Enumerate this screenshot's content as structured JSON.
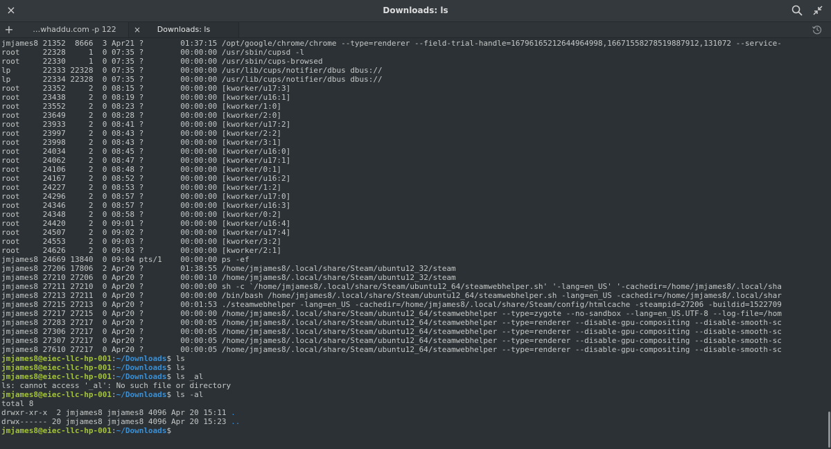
{
  "window": {
    "title": "Downloads: ls",
    "close_glyph": "×",
    "search_icon": "search-icon",
    "restore_icon": "restore-icon"
  },
  "tabs": {
    "add_glyph": "+",
    "items": [
      {
        "label": "…whaddu.com -p 122"
      },
      {
        "label": "Downloads: ls",
        "close_glyph": "×"
      }
    ],
    "history_icon": "history-icon"
  },
  "colors": {
    "background": "#2b3135",
    "text": "#c5c8c6",
    "prompt_user": "#a3c238",
    "prompt_path": "#3a8fd5"
  },
  "terminal": {
    "ps_lines": [
      "jmjames8 21352  8666  3 Apr21 ?        01:37:15 /opt/google/chrome/chrome --type=renderer --field-trial-handle=16796165212644964998,16671558278519887912,131072 --service-",
      "root     22328     1  0 07:35 ?        00:00:00 /usr/sbin/cupsd -l",
      "root     22330     1  0 07:35 ?        00:00:00 /usr/sbin/cups-browsed",
      "lp       22333 22328  0 07:35 ?        00:00:00 /usr/lib/cups/notifier/dbus dbus://",
      "lp       22334 22328  0 07:35 ?        00:00:00 /usr/lib/cups/notifier/dbus dbus://",
      "root     23352     2  0 08:15 ?        00:00:00 [kworker/u17:3]",
      "root     23438     2  0 08:19 ?        00:00:00 [kworker/u16:1]",
      "root     23552     2  0 08:23 ?        00:00:00 [kworker/1:0]",
      "root     23649     2  0 08:28 ?        00:00:00 [kworker/2:0]",
      "root     23933     2  0 08:41 ?        00:00:00 [kworker/u17:2]",
      "root     23997     2  0 08:43 ?        00:00:00 [kworker/2:2]",
      "root     23998     2  0 08:43 ?        00:00:00 [kworker/3:1]",
      "root     24034     2  0 08:45 ?        00:00:00 [kworker/u16:0]",
      "root     24062     2  0 08:47 ?        00:00:00 [kworker/u17:1]",
      "root     24106     2  0 08:48 ?        00:00:00 [kworker/0:1]",
      "root     24167     2  0 08:52 ?        00:00:00 [kworker/u16:2]",
      "root     24227     2  0 08:53 ?        00:00:00 [kworker/1:2]",
      "root     24296     2  0 08:57 ?        00:00:00 [kworker/u17:0]",
      "root     24346     2  0 08:57 ?        00:00:00 [kworker/u16:3]",
      "root     24348     2  0 08:58 ?        00:00:00 [kworker/0:2]",
      "root     24420     2  0 09:01 ?        00:00:00 [kworker/u16:4]",
      "root     24507     2  0 09:02 ?        00:00:00 [kworker/u17:4]",
      "root     24553     2  0 09:03 ?        00:00:00 [kworker/3:2]",
      "root     24626     2  0 09:03 ?        00:00:00 [kworker/2:1]",
      "jmjames8 24669 13840  0 09:04 pts/1    00:00:00 ps -ef",
      "jmjames8 27206 17806  2 Apr20 ?        01:38:55 /home/jmjames8/.local/share/Steam/ubuntu12_32/steam",
      "jmjames8 27210 27206  0 Apr20 ?        00:00:10 /home/jmjames8/.local/share/Steam/ubuntu12_32/steam",
      "jmjames8 27211 27210  0 Apr20 ?        00:00:00 sh -c `/home/jmjames8/.local/share/Steam/ubuntu12_64/steamwebhelper.sh' '-lang=en_US' '-cachedir=/home/jmjames8/.local/sha",
      "jmjames8 27213 27211  0 Apr20 ?        00:00:00 /bin/bash /home/jmjames8/.local/share/Steam/ubuntu12_64/steamwebhelper.sh -lang=en_US -cachedir=/home/jmjames8/.local/shar",
      "jmjames8 27215 27213  0 Apr20 ?        00:01:53 ./steamwebhelper -lang=en_US -cachedir=/home/jmjames8/.local/share/Steam/config/htmlcache -steampid=27206 -buildid=1522709",
      "jmjames8 27217 27215  0 Apr20 ?        00:00:00 /home/jmjames8/.local/share/Steam/ubuntu12_64/steamwebhelper --type=zygote --no-sandbox --lang=en_US.UTF-8 --log-file=/hom",
      "jmjames8 27283 27217  0 Apr20 ?        00:00:05 /home/jmjames8/.local/share/Steam/ubuntu12_64/steamwebhelper --type=renderer --disable-gpu-compositing --disable-smooth-sc",
      "jmjames8 27306 27217  0 Apr20 ?        00:00:05 /home/jmjames8/.local/share/Steam/ubuntu12_64/steamwebhelper --type=renderer --disable-gpu-compositing --disable-smooth-sc",
      "jmjames8 27307 27217  0 Apr20 ?        00:00:05 /home/jmjames8/.local/share/Steam/ubuntu12_64/steamwebhelper --type=renderer --disable-gpu-compositing --disable-smooth-sc",
      "jmjames8 27610 27217  0 Apr20 ?        00:00:05 /home/jmjames8/.local/share/Steam/ubuntu12_64/steamwebhelper --type=renderer --disable-gpu-compositing --disable-smooth-sc"
    ],
    "prompt_user": "jmjames8@eiec-llc-hp-001",
    "prompt_path": "~/Downloads",
    "prompt_suffix": "$ ",
    "session": [
      {
        "type": "prompt",
        "cmd": "ls"
      },
      {
        "type": "prompt",
        "cmd": "ls"
      },
      {
        "type": "prompt",
        "cmd": "ls _al"
      },
      {
        "type": "output",
        "text": "ls: cannot access '_al': No such file or directory"
      },
      {
        "type": "prompt",
        "cmd": "ls -al"
      },
      {
        "type": "output",
        "text": "total 8"
      },
      {
        "type": "dir",
        "text": "drwxr-xr-x  2 jmjames8 jmjames8 4096 Apr 20 15:11 ",
        "name": "."
      },
      {
        "type": "dir",
        "text": "drwx------ 20 jmjames8 jmjames8 4096 Apr 20 15:23 ",
        "name": ".."
      },
      {
        "type": "prompt",
        "cmd": ""
      }
    ]
  }
}
